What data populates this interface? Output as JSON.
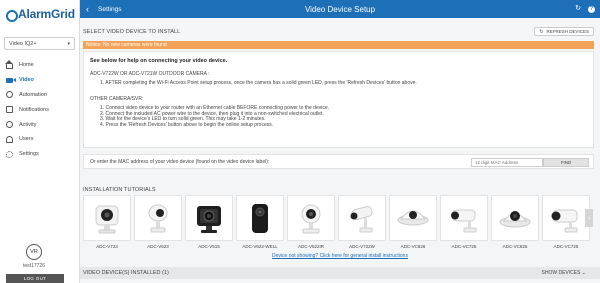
{
  "app": {
    "logo_text": "AlarmGrid",
    "panel_select": "Video IQ2+",
    "nav": [
      {
        "label": "Home",
        "icon": "home-icon"
      },
      {
        "label": "Video",
        "icon": "video-camera-icon"
      },
      {
        "label": "Automation",
        "icon": "automation-icon"
      },
      {
        "label": "Notifications",
        "icon": "notifications-icon"
      },
      {
        "label": "Activity",
        "icon": "activity-icon"
      },
      {
        "label": "Users",
        "icon": "users-icon"
      },
      {
        "label": "Settings",
        "icon": "settings-icon"
      }
    ],
    "avatar_initials": "VR",
    "username": "test17726",
    "logout": "LOG OUT"
  },
  "header": {
    "back": "‹",
    "breadcrumb": "Settings",
    "title": "Video Device Setup",
    "refresh_icon": "↻",
    "help_icon": "?"
  },
  "main": {
    "section_title": "SELECT VIDEO DEVICE TO INSTALL",
    "refresh_button": "REFRESH DEVICES",
    "notice": "Notice: No new cameras were found",
    "help_heading": "See below for help on connecting your video device.",
    "outdoor_title": "ADC-V722W OR ADC-V721W OUTDOOR CAMERA :",
    "outdoor_steps": [
      "1. AFTER completing the Wi-Fi Access Point setup process, once the camera has a solid green LED, press the 'Refresh Devices' button above."
    ],
    "other_title": "OTHER CAMERA/SVR:",
    "other_steps": [
      "1. Connect video device to your router with an Ethernet cable BEFORE connecting power to the device.",
      "2. Connect the included AC power wire to the device, then plug it into a non-switched electrical outlet.",
      "3. Wait for the device's LED to turn solid green. This may take 1-2 minutes.",
      "4. Press the 'Refresh Devices' button above to begin the online setup process."
    ],
    "mac_prompt": "Or enter the MAC address of your video device (found on the video device label):",
    "mac_placeholder": "12 digit MAC Address",
    "find_button": "FIND",
    "tutorials_title": "INSTALLATION TUTORIALS",
    "tutorials": [
      {
        "label": "ADC-V723"
      },
      {
        "label": "ADC-V523"
      },
      {
        "label": "ADC-V515"
      },
      {
        "label": "ADC-V622-WELL"
      },
      {
        "label": "ADC-V522IR"
      },
      {
        "label": "ADC-V722W"
      },
      {
        "label": "ADC-VC826"
      },
      {
        "label": "ADC-VC726"
      },
      {
        "label": "ADC-VC825"
      },
      {
        "label": "ADC-VC725"
      }
    ],
    "scroll_arrow": "›",
    "guide_link": "Device not showing? Click here for general install instructions",
    "installed_title": "VIDEO DEVICE(S) INSTALLED (1)",
    "show_devices": "SHOW DEVICES ⌄"
  },
  "colors": {
    "primary": "#1d6fb8",
    "notice": "#f3a259"
  }
}
